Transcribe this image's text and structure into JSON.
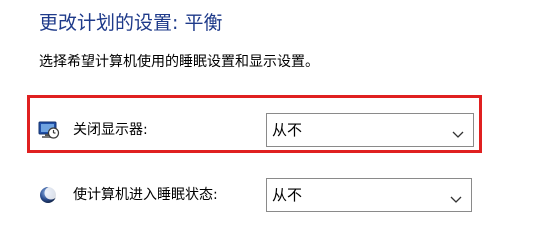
{
  "header": {
    "title": "更改计划的设置: 平衡",
    "subtitle": "选择希望计算机使用的睡眠设置和显示设置。"
  },
  "settings": {
    "turn_off_display": {
      "icon": "monitor-clock-icon",
      "label": "关闭显示器:",
      "selected": "从不"
    },
    "put_to_sleep": {
      "icon": "moon-icon",
      "label": "使计算机进入睡眠状态:",
      "selected": "从不"
    }
  },
  "colors": {
    "title": "#1e3a8a",
    "highlight": "#e02020",
    "select_border": "#8a8a8a"
  }
}
